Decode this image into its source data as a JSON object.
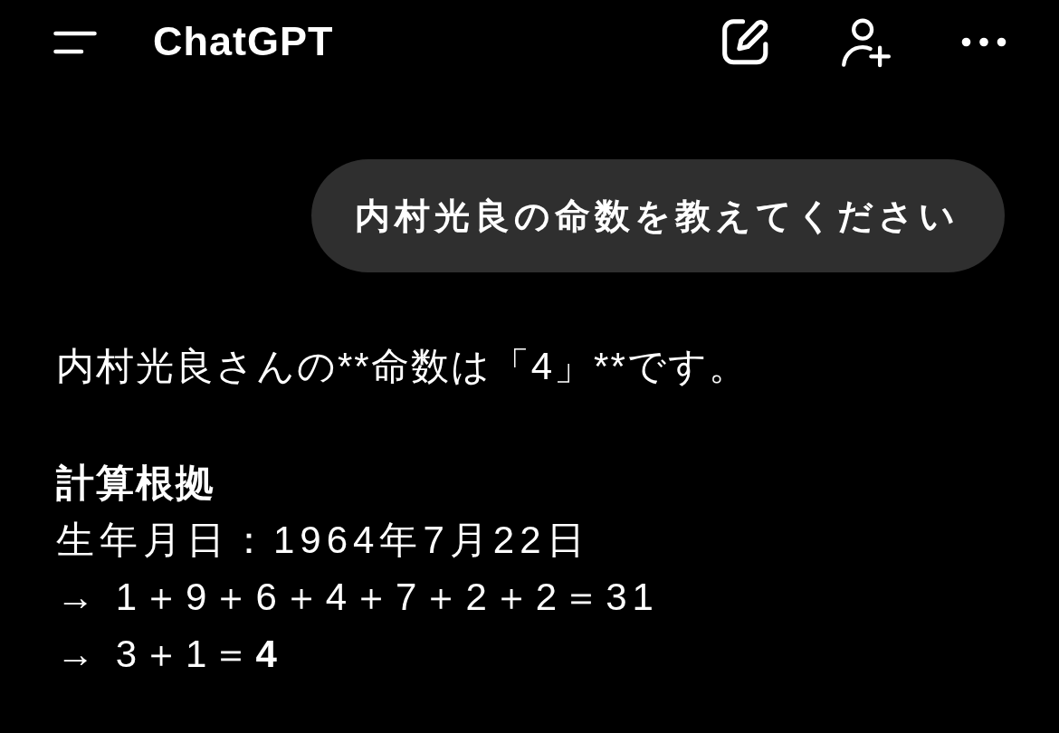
{
  "header": {
    "title": "ChatGPT"
  },
  "messages": [
    {
      "kind": "user",
      "text": "内村光良の命数を教えてください"
    },
    {
      "kind": "assistant",
      "blocks": [
        {
          "kind": "paragraph",
          "text": "内村光良さんの**命数は「4」**です。"
        },
        {
          "kind": "heading",
          "text": "計算根拠"
        },
        {
          "kind": "line",
          "text": "生年月日：1964年7月22日"
        },
        {
          "kind": "line",
          "text": "→ 1＋9＋6＋4＋7＋2＋2＝31"
        },
        {
          "kind": "line",
          "text": "→ 3＋1＝**4**"
        }
      ]
    }
  ]
}
